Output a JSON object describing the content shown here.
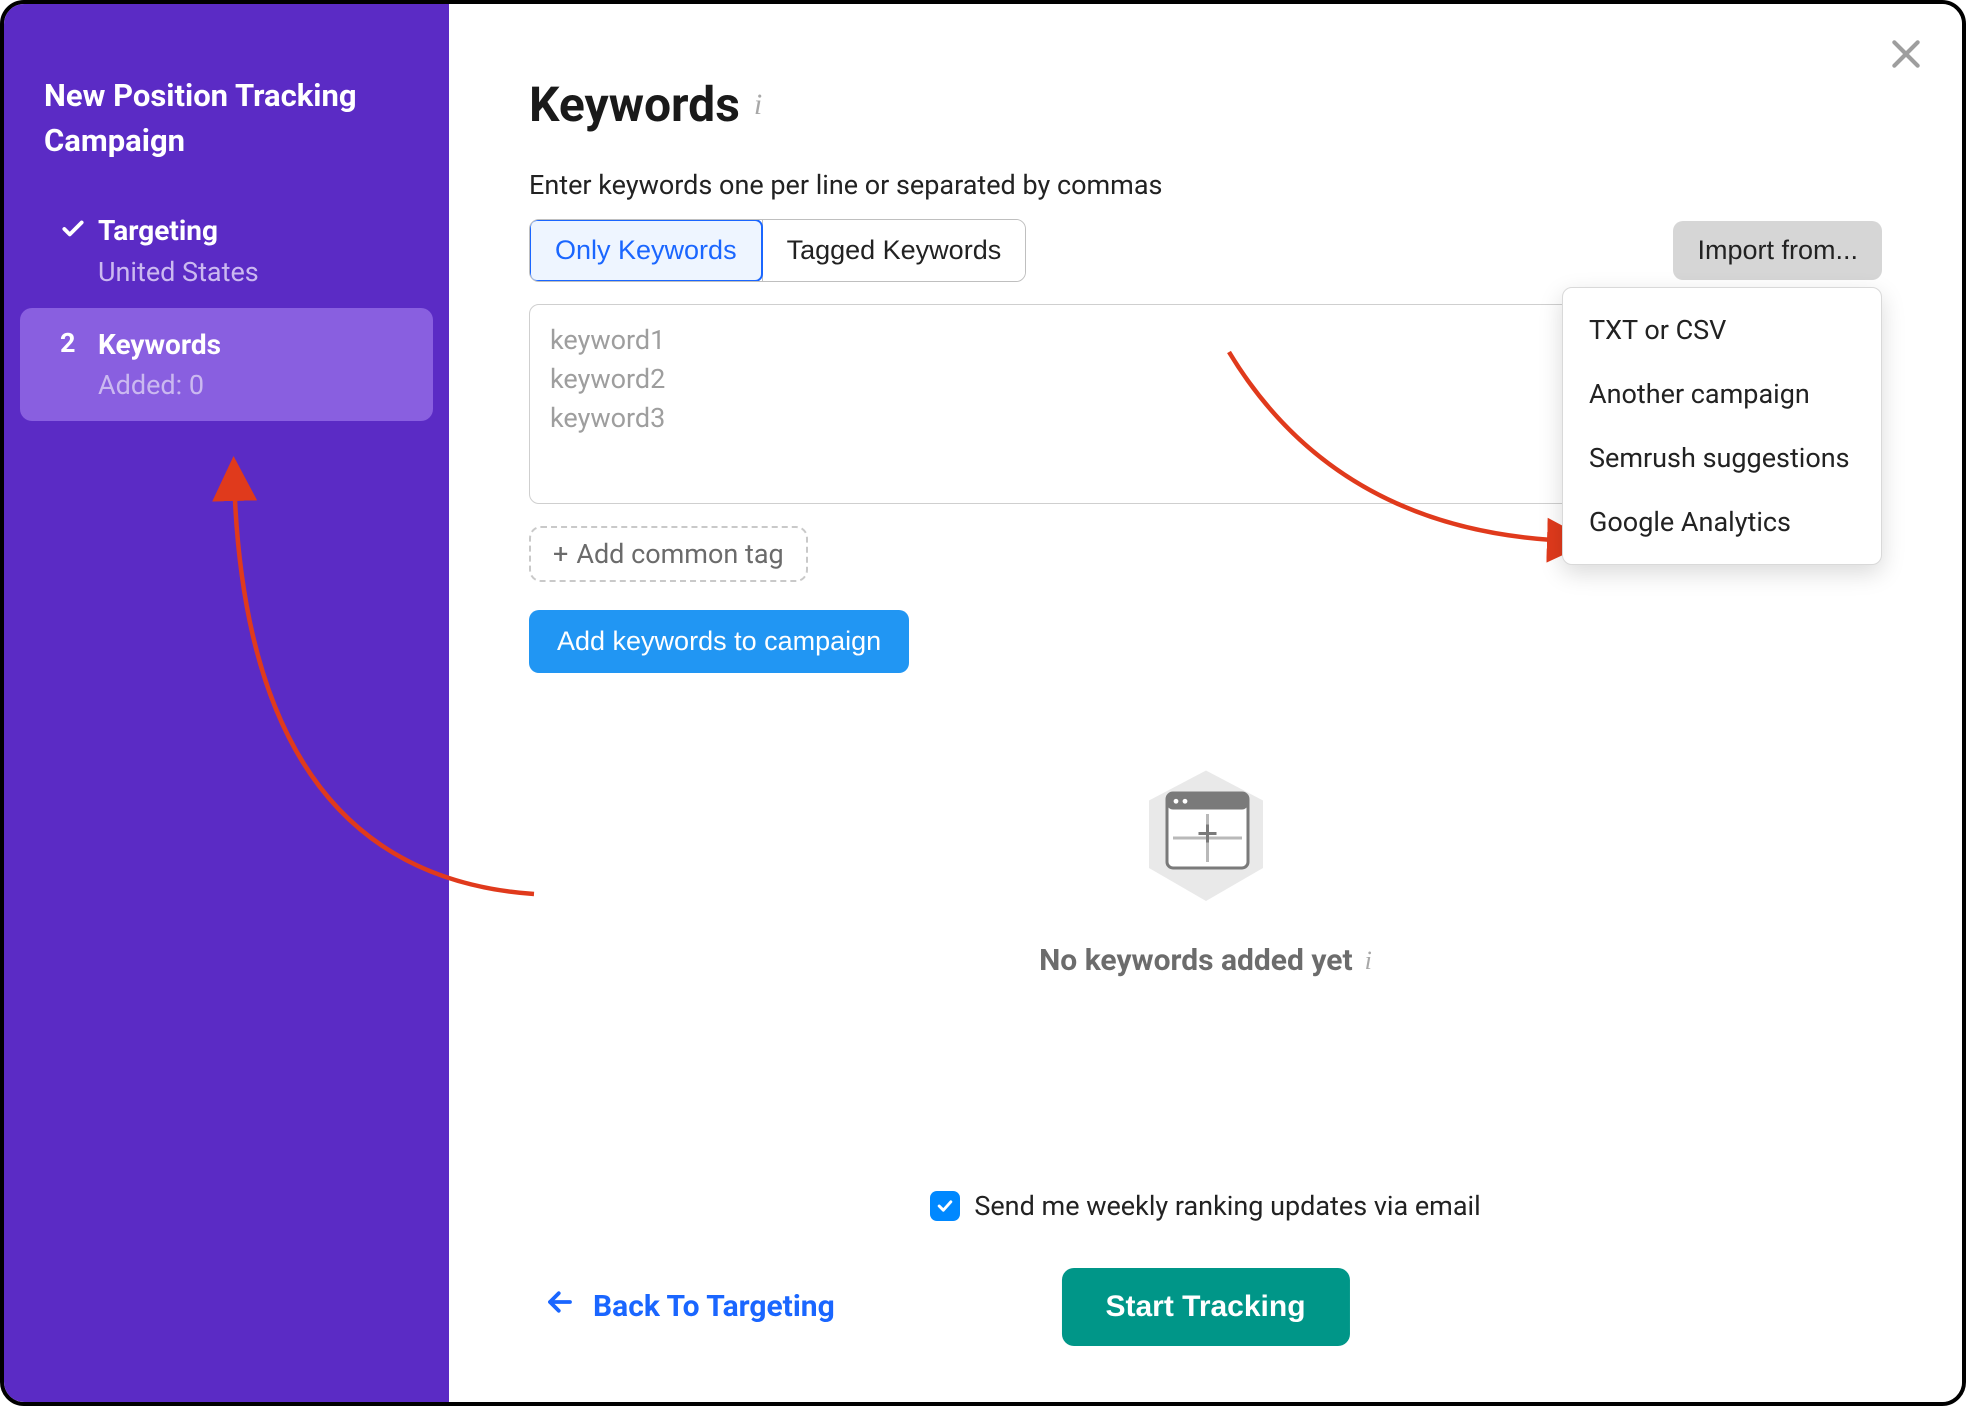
{
  "sidebar": {
    "title": "New Position Tracking Campaign",
    "items": [
      {
        "marker_type": "check",
        "label": "Targeting",
        "sub": "United States"
      },
      {
        "marker_type": "number",
        "marker": "2",
        "label": "Keywords",
        "sub": "Added: 0"
      }
    ]
  },
  "main": {
    "title": "Keywords",
    "instruction": "Enter keywords one per line or separated by commas",
    "segments": {
      "only": "Only Keywords",
      "tagged": "Tagged Keywords"
    },
    "import_button": "Import from...",
    "import_options": [
      "TXT or CSV",
      "Another campaign",
      "Semrush suggestions",
      "Google Analytics"
    ],
    "placeholder_lines": [
      "keyword1",
      "keyword2",
      "keyword3"
    ],
    "add_tag": "Add common tag",
    "add_kw_button": "Add keywords to campaign",
    "empty_text": "No keywords added yet",
    "email_label": "Send me weekly ranking updates via email",
    "back_label": "Back To Targeting",
    "start_label": "Start Tracking"
  }
}
